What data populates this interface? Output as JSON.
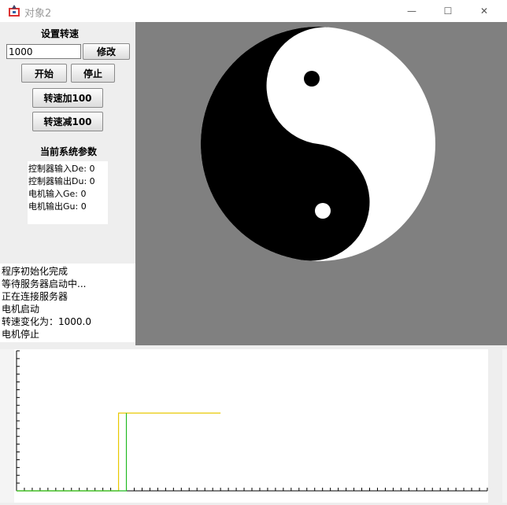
{
  "window": {
    "title": "对象2",
    "minimize_glyph": "—",
    "maximize_glyph": "☐",
    "close_glyph": "✕",
    "icon": "java-app-icon"
  },
  "controls": {
    "set_speed_label": "设置转速",
    "speed_value": "1000",
    "modify_label": "修改",
    "start_label": "开始",
    "stop_label": "停止",
    "speed_up_label": "转速加100",
    "speed_down_label": "转速减100"
  },
  "params": {
    "header": "当前系统参数",
    "lines": [
      "控制器输入De: 0",
      "控制器输出Du: 0",
      "电机输入Ge: 0",
      "电机输出Gu: 0"
    ]
  },
  "log": [
    "程序初始化完成",
    "等待服务器启动中...",
    "正在连接服务器",
    "电机启动",
    "转速变化为：1000.0",
    "电机停止"
  ],
  "colors": {
    "canvas_bg": "#808080",
    "setpoint_line": "#e8c800",
    "response_line": "#22bb22"
  },
  "chart_data": {
    "type": "line",
    "title": "",
    "xlabel": "",
    "ylabel": "",
    "grid": false,
    "series": [
      {
        "x": [
          0,
          13,
          13,
          26
        ],
        "y": [
          0,
          0,
          1000,
          1000
        ],
        "color": "#e8c800"
      },
      {
        "x": [
          0,
          14,
          14
        ],
        "y": [
          0,
          0,
          1000
        ],
        "color": "#22bb22"
      }
    ],
    "xlim": [
      0,
      60
    ],
    "ylim": [
      0,
      1800
    ],
    "x_ticks": 60,
    "y_ticks": 18
  }
}
